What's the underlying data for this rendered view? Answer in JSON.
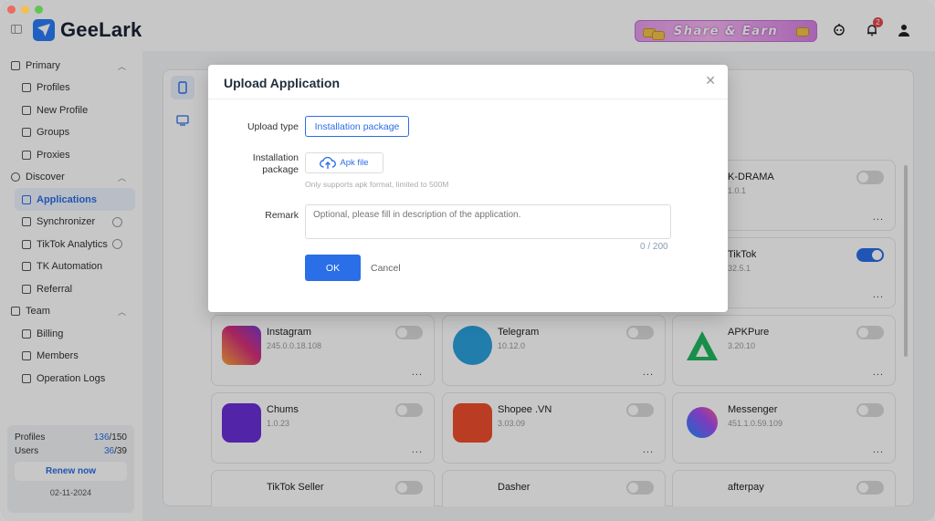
{
  "app": {
    "name": "GeeLark",
    "share_banner": "Share & Earn",
    "notification_count": "2"
  },
  "sidebar": {
    "groups": [
      {
        "label": "Primary",
        "items": [
          "Profiles",
          "New Profile",
          "Groups",
          "Proxies"
        ]
      },
      {
        "label": "Discover",
        "items": [
          "Applications",
          "Synchronizer",
          "TikTok Analytics",
          "TK Automation",
          "Referral"
        ]
      },
      {
        "label": "Team",
        "items": [
          "Billing",
          "Members",
          "Operation Logs"
        ]
      }
    ],
    "active_item": "Applications"
  },
  "usage": {
    "profiles_label": "Profiles",
    "profiles_used": "136",
    "profiles_total": "/150",
    "users_label": "Users",
    "users_used": "36",
    "users_total": "/39",
    "renew_label": "Renew now",
    "expiry_date": "02-11-2024"
  },
  "apps": [
    {
      "name": "K-DRAMA",
      "version": "1.0.1",
      "enabled": false,
      "icon_color": "#ffffff"
    },
    {
      "name": "TikTok",
      "version": "32.5.1",
      "enabled": true,
      "icon_color": "#ffffff"
    },
    {
      "name": "Instagram",
      "version": "245.0.0.18.108",
      "enabled": false,
      "icon_color": "#d6307a"
    },
    {
      "name": "Telegram",
      "version": "10.12.0",
      "enabled": false,
      "icon_color": "#2aa1dd"
    },
    {
      "name": "APKPure",
      "version": "3.20.10",
      "enabled": false,
      "icon_color": "#21b760"
    },
    {
      "name": "Chums",
      "version": "1.0.23",
      "enabled": false,
      "icon_color": "#6a2fd8"
    },
    {
      "name": "Shopee .VN",
      "version": "3.03.09",
      "enabled": false,
      "icon_color": "#ee4d2d"
    },
    {
      "name": "Messenger",
      "version": "451.1.0.59.109",
      "enabled": false,
      "icon_color": "#8a55f7"
    },
    {
      "name": "TikTok Seller",
      "version": "",
      "enabled": false,
      "icon_color": "#ffffff"
    },
    {
      "name": "Dasher",
      "version": "",
      "enabled": false,
      "icon_color": "#ffffff"
    },
    {
      "name": "afterpay",
      "version": "",
      "enabled": false,
      "icon_color": "#b2fce4"
    }
  ],
  "more_label": "...",
  "modal": {
    "title": "Upload Application",
    "close_glyph": "✕",
    "upload_type_label": "Upload type",
    "upload_type_value": "Installation package",
    "package_label_line1": "Installation",
    "package_label_line2": "package",
    "apk_button_label": "Apk file",
    "hint": "Only supports apk format, limited to 500M",
    "remark_label": "Remark",
    "remark_placeholder": "Optional, please fill in description of the application.",
    "counter": "0 / 200",
    "ok_label": "OK",
    "cancel_label": "Cancel"
  },
  "colors": {
    "accent": "#2a6ee8",
    "banner": "#e49ce8"
  }
}
